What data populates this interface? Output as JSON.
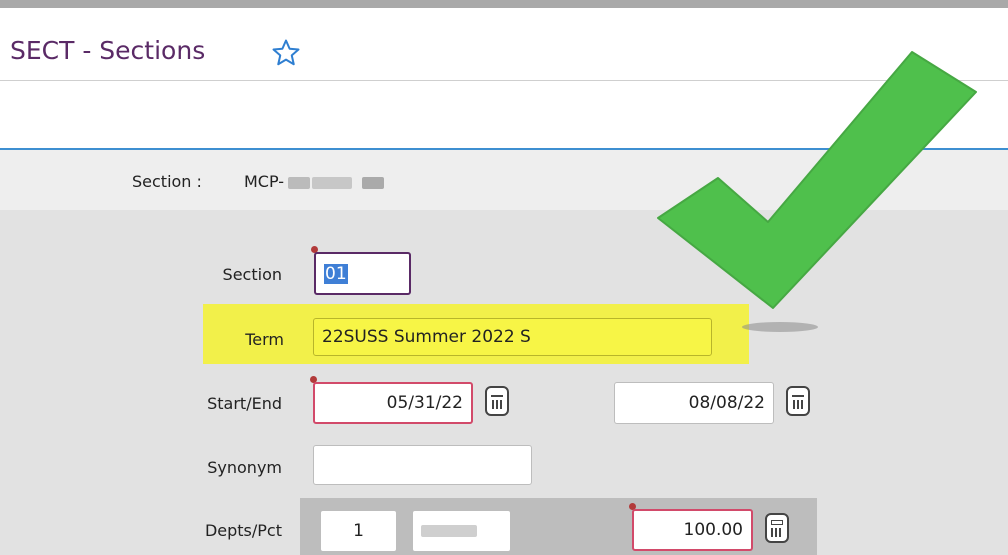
{
  "header": {
    "title": "SECT - Sections",
    "favorite_icon": "star-outline-icon"
  },
  "section_bar": {
    "label": "Section :",
    "value_visible": "MCP-"
  },
  "form": {
    "section": {
      "label": "Section",
      "value": "01"
    },
    "term": {
      "label": "Term",
      "value": "22SUSS Summer 2022 S"
    },
    "start_end": {
      "label": "Start/End",
      "start": "05/31/22",
      "end": "08/08/22"
    },
    "synonym": {
      "label": "Synonym",
      "value": ""
    },
    "depts_pct": {
      "label": "Depts/Pct",
      "number": "1",
      "pct": "100.00"
    }
  },
  "colors": {
    "title": "#5a2a66",
    "highlight": "#f2f04a",
    "checkmark": "#4fc04c",
    "required_border": "#d24a6a"
  }
}
